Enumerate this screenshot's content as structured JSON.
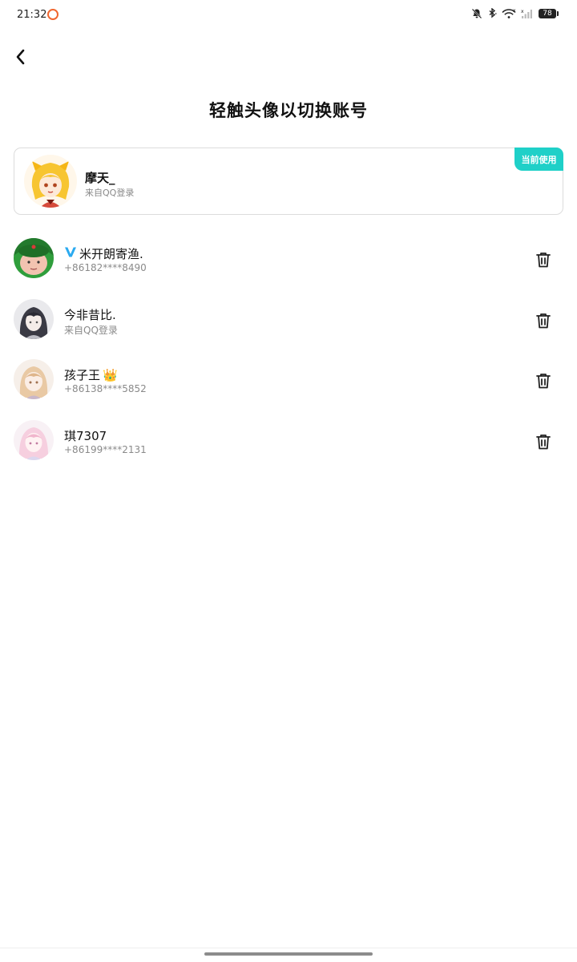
{
  "status_bar": {
    "time": "21:32",
    "battery": "78",
    "icons": [
      "recording-ring-icon",
      "bell-off-icon",
      "bluetooth-icon",
      "wifi-icon",
      "no-signal-icon",
      "battery-icon"
    ]
  },
  "header": {
    "back_icon": "chevron-left-icon",
    "title": "轻触头像以切换账号"
  },
  "current_account": {
    "badge": "当前使用",
    "name": "摩天_",
    "login_source": "来自QQ登录"
  },
  "accounts": [
    {
      "name": "米开朗寄渔.",
      "sub": "+86182****8490",
      "name_badge": "V",
      "delete_icon": "trash-icon"
    },
    {
      "name": "今非昔比.",
      "sub": "来自QQ登录",
      "name_badge": "",
      "delete_icon": "trash-icon"
    },
    {
      "name": "孩子王",
      "sub": "+86138****5852",
      "name_badge": "👑",
      "delete_icon": "trash-icon"
    },
    {
      "name": "琪7307",
      "sub": "+86199****2131",
      "name_badge": "",
      "delete_icon": "trash-icon"
    }
  ],
  "colors": {
    "accent": "#1fd0c8",
    "vip_badge": "#2aaaf0",
    "recording_ring": "#f0662f"
  }
}
